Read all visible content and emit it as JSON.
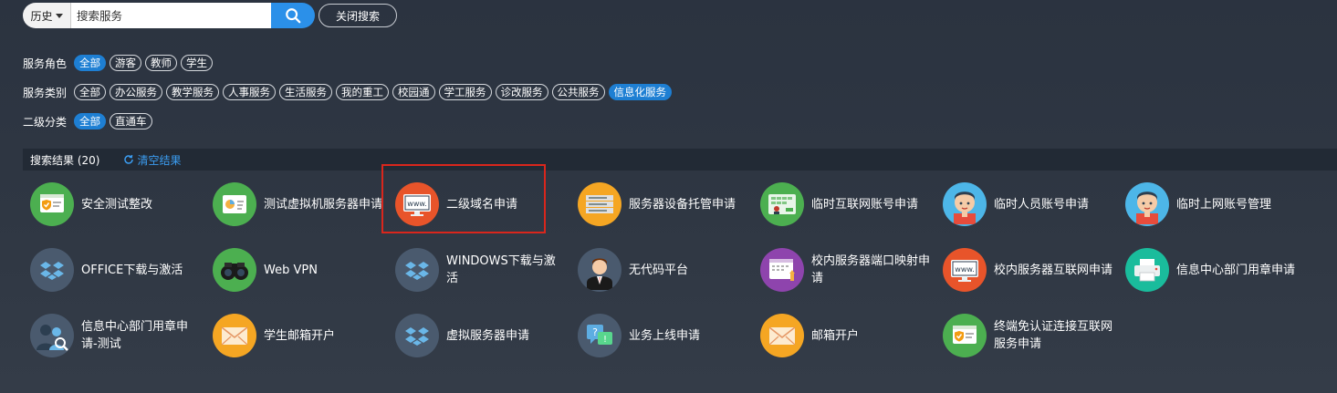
{
  "search": {
    "history_label": "历史",
    "placeholder": "搜索服务",
    "close_label": "关闭搜索"
  },
  "filters": {
    "role": {
      "label": "服务角色",
      "chips": [
        "全部",
        "游客",
        "教师",
        "学生"
      ],
      "active": 0
    },
    "category": {
      "label": "服务类别",
      "chips": [
        "全部",
        "办公服务",
        "教学服务",
        "人事服务",
        "生活服务",
        "我的重工",
        "校园通",
        "学工服务",
        "诊改服务",
        "公共服务",
        "信息化服务"
      ],
      "active": 10
    },
    "sub": {
      "label": "二级分类",
      "chips": [
        "全部",
        "直通车"
      ],
      "active": 0
    }
  },
  "results": {
    "title": "搜索结果 (20)",
    "clear_label": "清空结果"
  },
  "items": [
    {
      "label": "安全测试整改",
      "icon": "security-shield-icon",
      "bg": "#4caf50"
    },
    {
      "label": "测试虚拟机服务器申请",
      "icon": "vm-chart-icon",
      "bg": "#4caf50"
    },
    {
      "label": "二级域名申请",
      "icon": "www-monitor-icon",
      "bg": "#e8542a"
    },
    {
      "label": "服务器设备托管申请",
      "icon": "server-rack-icon",
      "bg": "#f5a623"
    },
    {
      "label": "临时互联网账号申请",
      "icon": "account-card-icon",
      "bg": "#4caf50"
    },
    {
      "label": "临时人员账号申请",
      "icon": "person-icon",
      "bg": "#4db6e8"
    },
    {
      "label": "临时上网账号管理",
      "icon": "person-icon",
      "bg": "#4db6e8"
    },
    {
      "label": "OFFICE下载与激活",
      "icon": "dropbox-icon",
      "bg": "#4a5a6e"
    },
    {
      "label": "Web VPN",
      "icon": "binoculars-icon",
      "bg": "#4caf50"
    },
    {
      "label": "WINDOWS下载与激活",
      "icon": "dropbox-icon",
      "bg": "#4a5a6e"
    },
    {
      "label": "无代码平台",
      "icon": "businessman-icon",
      "bg": "#4a5a6e"
    },
    {
      "label": "校内服务器端口映射申请",
      "icon": "port-mapping-icon",
      "bg": "#8e44ad"
    },
    {
      "label": "校内服务器互联网申请",
      "icon": "www-monitor-icon",
      "bg": "#e8542a"
    },
    {
      "label": "信息中心部门用章申请",
      "icon": "printer-icon",
      "bg": "#1abc9c"
    },
    {
      "label": "信息中心部门用章申请-测试",
      "icon": "team-search-icon",
      "bg": "#4a5a6e"
    },
    {
      "label": "学生邮箱开户",
      "icon": "envelope-icon",
      "bg": "#f5a623"
    },
    {
      "label": "虚拟服务器申请",
      "icon": "dropbox-icon",
      "bg": "#4a5a6e"
    },
    {
      "label": "业务上线申请",
      "icon": "help-chat-icon",
      "bg": "#4a5a6e"
    },
    {
      "label": "邮箱开户",
      "icon": "envelope-icon",
      "bg": "#f5a623"
    },
    {
      "label": "终端免认证连接互联网服务申请",
      "icon": "security-shield-icon",
      "bg": "#4caf50"
    }
  ]
}
